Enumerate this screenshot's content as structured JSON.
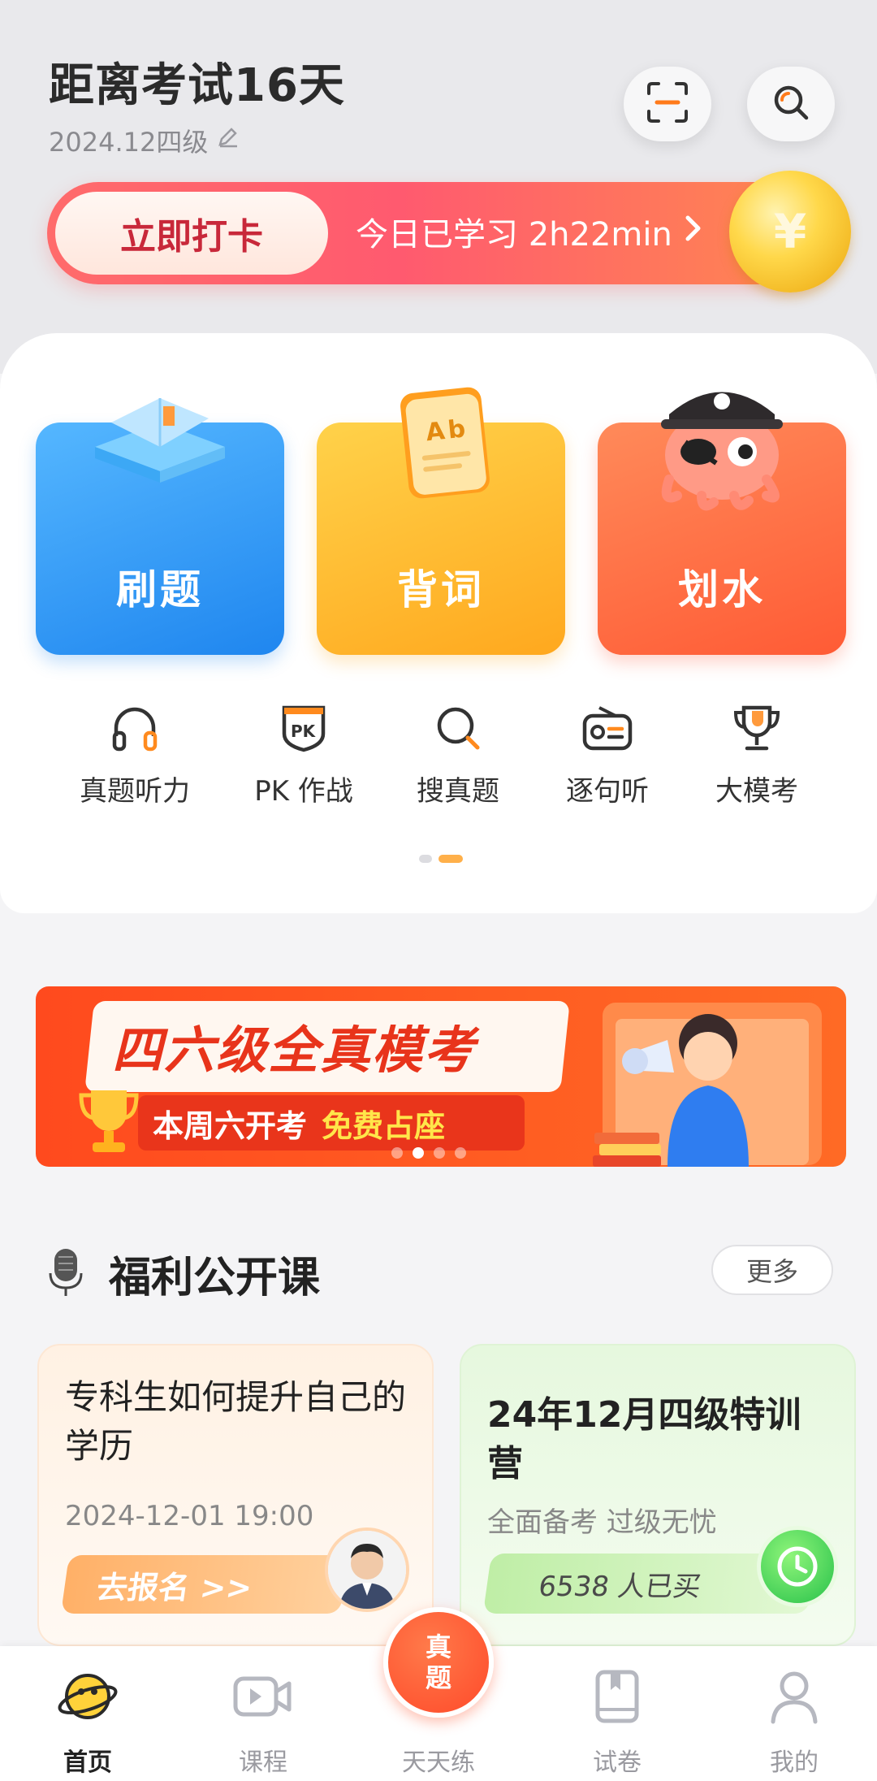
{
  "header": {
    "exam_countdown": "距离考试16天",
    "exam_info": "2024.12四级",
    "scan_icon": "scan-icon",
    "search_icon": "search-icon"
  },
  "checkin": {
    "button_label": "立即打卡",
    "study_text": "今日已学习 2h22min",
    "coin_symbol": "¥"
  },
  "features": [
    {
      "label": "刷题",
      "icon": "book-icon",
      "color": "#2a90f2"
    },
    {
      "label": "背词",
      "icon": "word-card-icon",
      "color": "#ffb126"
    },
    {
      "label": "划水",
      "icon": "pirate-octopus-icon",
      "color": "#ff6640"
    }
  ],
  "quick_entries": [
    {
      "label": "真题听力",
      "icon": "headphones-icon"
    },
    {
      "label": "PK 作战",
      "icon": "pk-shield-icon"
    },
    {
      "label": "搜真题",
      "icon": "search-icon"
    },
    {
      "label": "逐句听",
      "icon": "radio-icon"
    },
    {
      "label": "大模考",
      "icon": "trophy-icon"
    }
  ],
  "promo": {
    "title": "四六级全真模考",
    "sub_prefix": "本周六开考",
    "sub_highlight": "免费占座"
  },
  "section": {
    "title": "福利公开课",
    "more": "更多"
  },
  "courses": [
    {
      "title": "专科生如何提升自己的学历",
      "time": "2024-12-01 19:00",
      "action": "去报名 >>"
    },
    {
      "title": "24年12月四级特训营",
      "subtitle": "全面备考 过级无忧",
      "bought": "6538 人已买"
    }
  ],
  "tabbar": {
    "items": [
      {
        "label": "首页",
        "icon": "planet-icon"
      },
      {
        "label": "课程",
        "icon": "video-icon"
      },
      {
        "label": "天天练",
        "icon": "practice-icon",
        "bubble": "真题"
      },
      {
        "label": "试卷",
        "icon": "paper-icon"
      },
      {
        "label": "我的",
        "icon": "profile-icon"
      }
    ],
    "active_index": 0
  },
  "colors": {
    "accent": "#ff5a3c",
    "checkin_gradient": "#ff6b6b"
  }
}
